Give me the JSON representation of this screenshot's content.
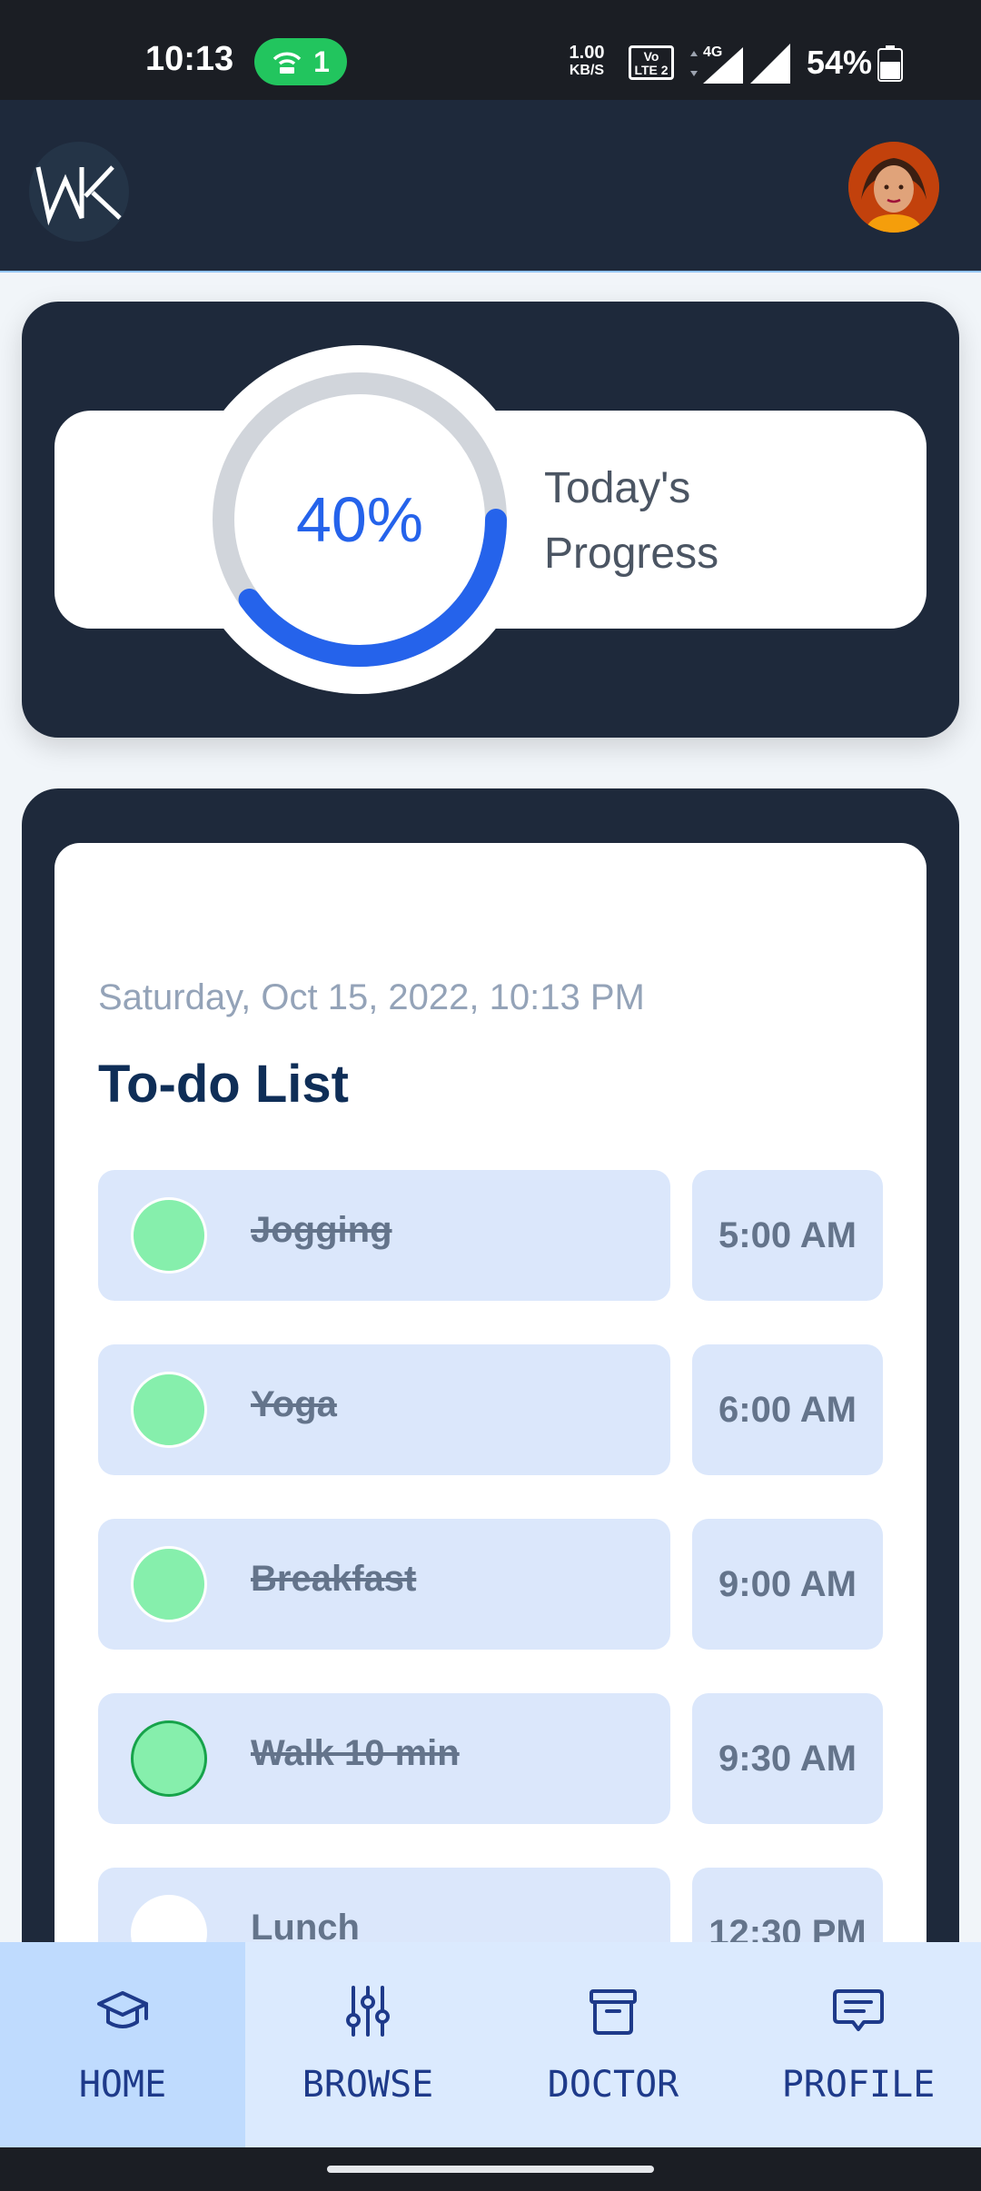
{
  "status_bar": {
    "time": "10:13",
    "hotspot_count": "1",
    "net_speed_value": "1.00",
    "net_speed_unit": "KB/S",
    "volte_line1": "Vo",
    "volte_line2": "LTE 2",
    "network_type": "4G",
    "battery_percent": "54%"
  },
  "progress": {
    "value_text": "40%",
    "fraction": 0.4,
    "label_line1": "Today's",
    "label_line2": "Progress",
    "accent_color": "#2563eb"
  },
  "todo": {
    "date": "Saturday, Oct 15, 2022, 10:13 PM",
    "title": "To-do List",
    "tasks": [
      {
        "name": "Jogging",
        "time": "5:00 AM",
        "done": true
      },
      {
        "name": "Yoga",
        "time": "6:00 AM",
        "done": true
      },
      {
        "name": "Breakfast",
        "time": "9:00 AM",
        "done": true
      },
      {
        "name": "Walk 10 min",
        "time": "9:30 AM",
        "done": true
      },
      {
        "name": "Lunch",
        "time": "12:30 PM",
        "done": false
      }
    ]
  },
  "nav": {
    "items": [
      {
        "label": "HOME",
        "icon": "graduation-cap-icon",
        "active": true
      },
      {
        "label": "BROWSE",
        "icon": "sliders-icon",
        "active": false
      },
      {
        "label": "DOCTOR",
        "icon": "archive-box-icon",
        "active": false
      },
      {
        "label": "PROFILE",
        "icon": "chat-message-icon",
        "active": false
      }
    ]
  }
}
